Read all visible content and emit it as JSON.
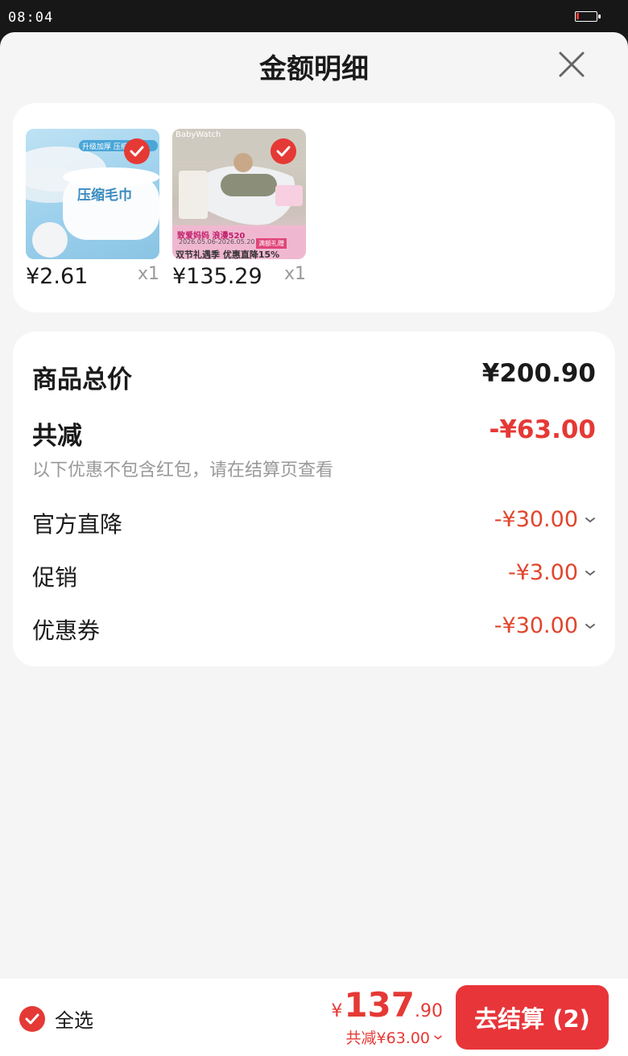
{
  "status_bar": {
    "time": "08:04",
    "battery_level": 0.12
  },
  "sheet": {
    "title": "金额明细",
    "close_icon": "close-icon"
  },
  "products": [
    {
      "price": "¥2.61",
      "qty": "x1",
      "image_text_top": "升级加厚 压缩毛巾",
      "image_text_main": "压缩毛巾",
      "selected": true
    },
    {
      "price": "¥135.29",
      "qty": "x1",
      "image_text_top": "BabyWatch",
      "image_text_banner": "双节礼遇季 优惠直降15%",
      "image_text_promo": "致爱妈妈 浪漫520",
      "image_text_date": "2026.05.06-2026.05.20",
      "image_text_gift": "满额礼赠",
      "selected": true
    }
  ],
  "summary": {
    "total_label": "商品总价",
    "total_value": "¥200.90",
    "discount_label": "共减",
    "discount_value": "-¥63.00",
    "note": "以下优惠不包含红包，请在结算页查看",
    "items": [
      {
        "label": "官方直降",
        "value": "-¥30.00"
      },
      {
        "label": "促销",
        "value": "-¥3.00"
      },
      {
        "label": "优惠券",
        "value": "-¥30.00"
      }
    ]
  },
  "bottom_bar": {
    "select_all_label": "全选",
    "currency": "¥",
    "total_int": "137",
    "total_dec": ".90",
    "discount_text": "共减¥63.00",
    "checkout_label": "去结算 (2)"
  },
  "colors": {
    "accent": "#e53935",
    "discount_red": "#e0452c",
    "background": "#f5f5f5"
  }
}
